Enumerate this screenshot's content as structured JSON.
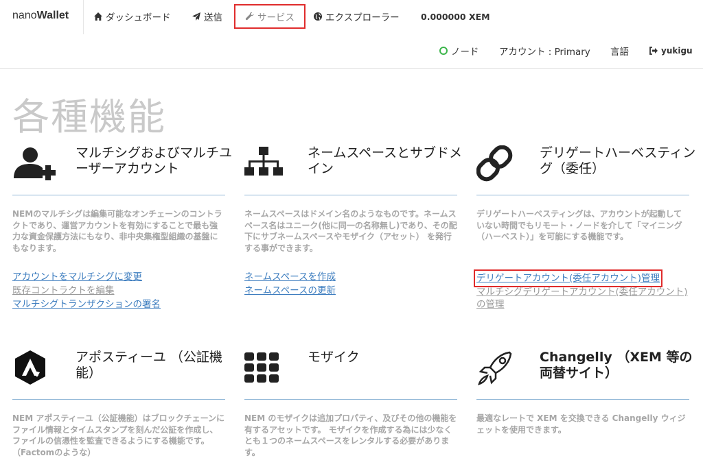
{
  "navbar": {
    "brand_light": "nano",
    "brand_bold": "Wallet",
    "dashboard_label": "ダッシュボード",
    "send_label": "送信",
    "services_label": "サービス",
    "explorer_label": "エクスプローラー",
    "balance": "0.000000 XEM",
    "node_label": "ノード",
    "account_label": "アカウント : Primary",
    "language_label": "言語",
    "user_label": "yukigu"
  },
  "colors": {
    "highlight": "#e02b2b",
    "link": "#3d7dbf",
    "node_ok": "#3bb54a"
  },
  "page": {
    "title": "各種機能"
  },
  "cards": [
    {
      "icon": "add-user-icon",
      "title": "マルチシグおよびマルチユーザーアカウント",
      "description": "NEMのマルチシグは編集可能なオンチェーンのコントラクトであり、運営アカウントを有効にすることで最も強力な資金保護方法にもなり、非中央集権型組織の基盤にもなります。",
      "links": [
        "アカウントをマルチシグに変更",
        "既存コントラクトを編集",
        "マルチシグトランザクションの署名"
      ]
    },
    {
      "icon": "sitemap-icon",
      "title": "ネームスペースとサブドメイン",
      "description": "ネームスペースはドメイン名のようなものです。ネームスペース名はユニーク(他に同一の名称無し)であり、その配下にサブネームスペースやモザイク（アセット） を発行する事ができます。",
      "links": [
        "ネームスペースを作成",
        "ネームスペースの更新"
      ]
    },
    {
      "icon": "chain-link-icon",
      "title": "デリゲートハーベスティング（委任）",
      "description": "デリゲートハーベスティングは、アカウントが起動していない時間でもリモート・ノードを介して「マイニング（ハーベスト）」を可能にする機能です。",
      "links": [
        "デリゲートアカウント(委任アカウント)管理",
        "マルチシグデリゲートアカウント(委任アカウント)の管理"
      ]
    },
    {
      "icon": "apostille-icon",
      "title": "アポスティーユ （公証機能）",
      "description": "NEM アポスティーユ（公証機能）はブロックチェーンにファイル情報とタイムスタンプを刻んだ公証を作成し、ファイルの信憑性を監査できるようにする機能です。（Factomのような）"
    },
    {
      "icon": "mosaic-grid-icon",
      "title": "モザイク",
      "description": "NEM のモザイクは追加プロパティ、及びその他の機能を有するアセットです。 モザイクを作成する為には少なくとも１つのネームスペースをレンタルする必要があります。"
    },
    {
      "icon": "rocket-icon",
      "title": "Changelly （XEM 等の両替サイト）",
      "description": "最適なレートで XEM を交換できる Changelly ウィジェットを使用できます。"
    }
  ]
}
